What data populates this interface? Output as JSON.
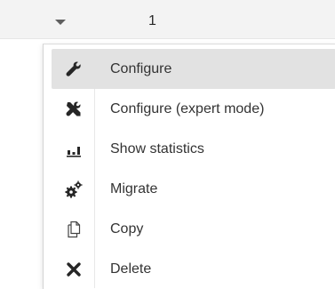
{
  "header": {
    "row_number": "1"
  },
  "menu": {
    "items": [
      {
        "label": "Configure",
        "icon": "wrench-icon"
      },
      {
        "label": "Configure (expert mode)",
        "icon": "tools-icon"
      },
      {
        "label": "Show statistics",
        "icon": "bar-chart-icon"
      },
      {
        "label": "Migrate",
        "icon": "gears-icon"
      },
      {
        "label": "Copy",
        "icon": "copy-icon"
      },
      {
        "label": "Delete",
        "icon": "delete-x-icon"
      }
    ]
  }
}
